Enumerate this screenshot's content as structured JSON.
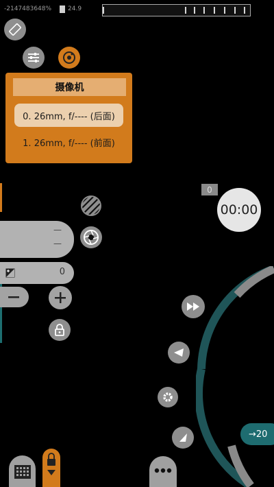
{
  "status_bar": {
    "left_text": "-2147483648%",
    "battery_text": "24.9"
  },
  "camera_panel": {
    "title": "摄像机",
    "options": [
      {
        "label": "0. 26mm, f/---- (后面)",
        "selected": true
      },
      {
        "label": "1. 26mm, f/---- (前面)",
        "selected": false
      }
    ]
  },
  "left_controls": {
    "value_line_1": "—",
    "value_line_2": "—",
    "exposure_value": "0"
  },
  "timer": {
    "counter": "0",
    "time": "00:00"
  },
  "zoom": {
    "label": "→2",
    "suffix": "0"
  },
  "colors": {
    "accent_orange": "#d27b1c",
    "accent_teal": "#1e6c70",
    "button_gray": "#8e8e8e"
  }
}
